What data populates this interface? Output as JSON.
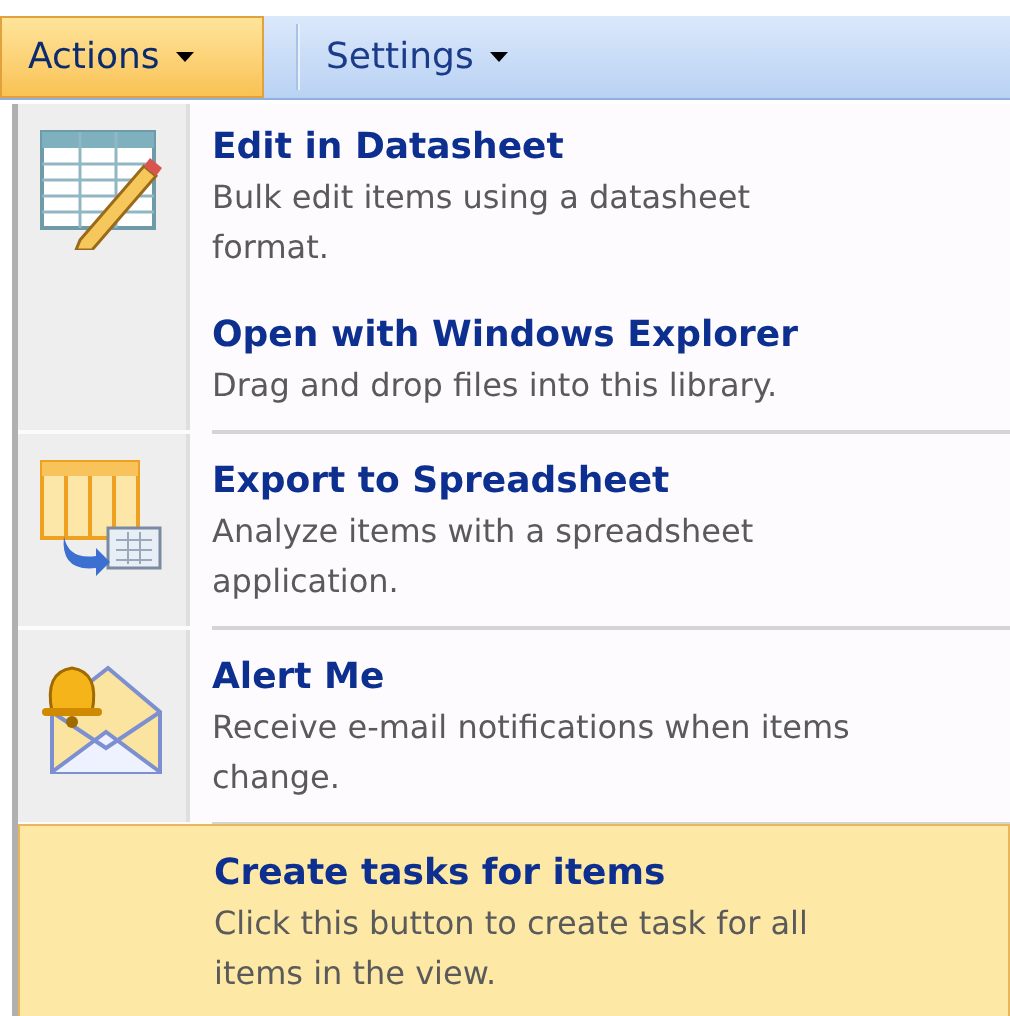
{
  "toolbar": [
    {
      "label": "Actions",
      "selected": true
    },
    {
      "label": "Settings",
      "selected": false
    }
  ],
  "menu": [
    {
      "kind": "datasheet",
      "divider": false,
      "selected": false,
      "title": "Edit in Datasheet",
      "description": "Bulk edit items using a datasheet format."
    },
    {
      "kind": "plain",
      "divider": false,
      "selected": false,
      "title": "Open with Windows Explorer",
      "description": "Drag and drop files into this library."
    },
    {
      "kind": "export",
      "divider": true,
      "selected": false,
      "title": "Export to Spreadsheet",
      "description": "Analyze items with a spreadsheet application."
    },
    {
      "kind": "alert",
      "divider": true,
      "selected": false,
      "title": "Alert Me",
      "description": "Receive e-mail notifications when items change."
    },
    {
      "kind": "plain",
      "divider": true,
      "selected": true,
      "title": "Create tasks for items",
      "description": "Click this button to create task for all items in the view."
    }
  ]
}
